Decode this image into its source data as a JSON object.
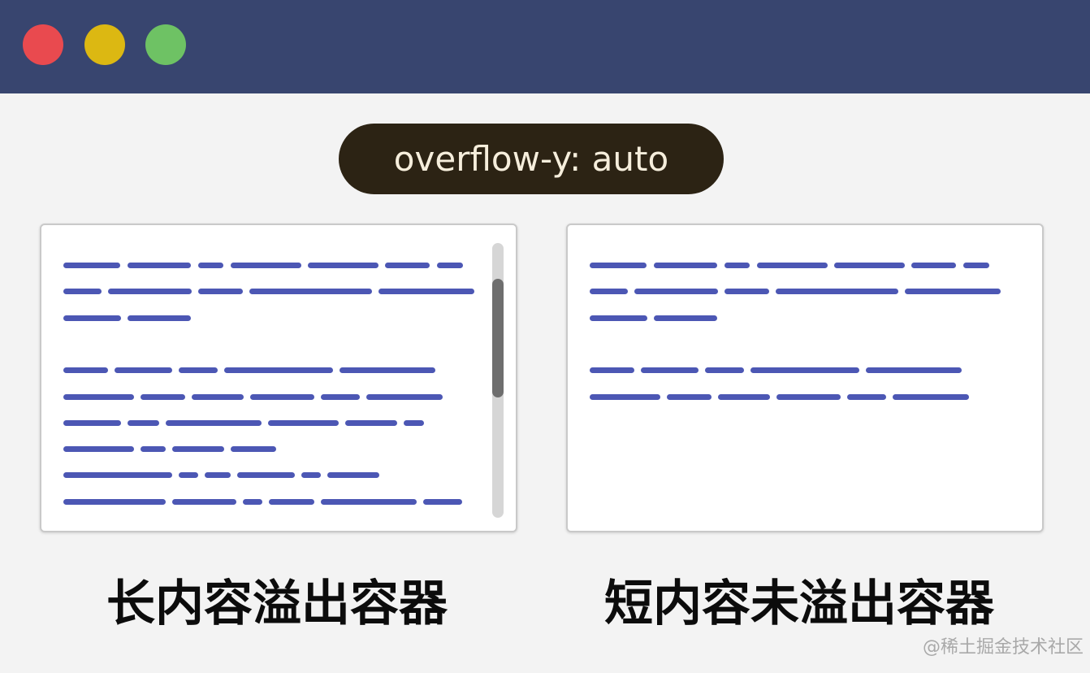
{
  "window": {
    "controls": [
      {
        "name": "close",
        "color": "#e94a4f"
      },
      {
        "name": "minimize",
        "color": "#dcb812"
      },
      {
        "name": "maximize",
        "color": "#6ec264"
      }
    ]
  },
  "badge": {
    "label": "overflow-y: auto"
  },
  "panels": {
    "left": {
      "caption": "长内容溢出容器",
      "has_scrollbar": true
    },
    "right": {
      "caption": "短内容未溢出容器",
      "has_scrollbar": false
    }
  },
  "watermark": "@稀土掘金技术社区",
  "colors": {
    "text_line": "#4c57b4",
    "titlebar": "#38456f",
    "badge_bg": "#2c2314"
  }
}
